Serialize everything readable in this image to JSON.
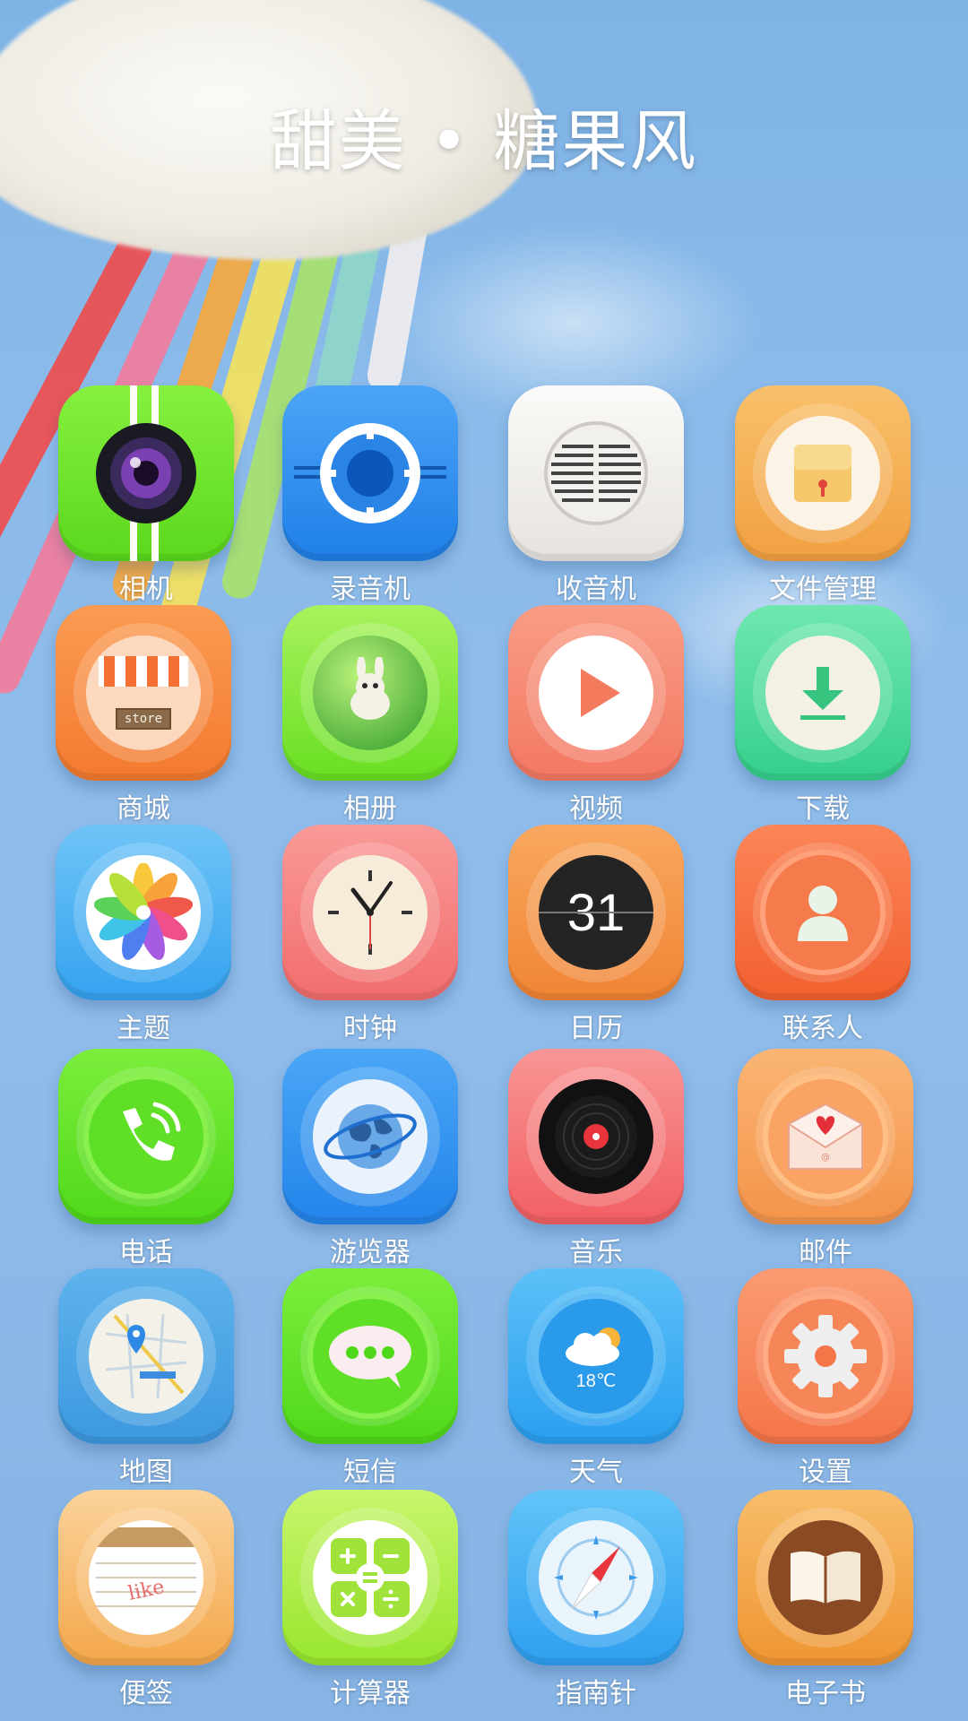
{
  "title": "甜美 • 糖果风",
  "apps": [
    {
      "label": "相机",
      "icon": "camera-icon",
      "color": "#6ee52c"
    },
    {
      "label": "录音机",
      "icon": "recorder-icon",
      "color": "#2f8ff0"
    },
    {
      "label": "收音机",
      "icon": "radio-icon",
      "color": "#efedea"
    },
    {
      "label": "文件管理",
      "icon": "folder-icon",
      "color": "#f6b05a"
    },
    {
      "label": "商城",
      "icon": "store-icon",
      "color": "#f98a43"
    },
    {
      "label": "相册",
      "icon": "album-icon",
      "color": "#86e93b"
    },
    {
      "label": "视频",
      "icon": "play-icon",
      "color": "#f7866f"
    },
    {
      "label": "下载",
      "icon": "download-icon",
      "color": "#49d99a"
    },
    {
      "label": "主题",
      "icon": "theme-flower-icon",
      "color": "#4fb4f4"
    },
    {
      "label": "时钟",
      "icon": "clock-icon",
      "color": "#f57f7f"
    },
    {
      "label": "日历",
      "icon": "calendar-icon",
      "color": "#f6954a"
    },
    {
      "label": "联系人",
      "icon": "contact-icon",
      "color": "#f86f43"
    },
    {
      "label": "电话",
      "icon": "phone-icon",
      "color": "#5fe32a"
    },
    {
      "label": "游览器",
      "icon": "browser-globe-icon",
      "color": "#3d98f2"
    },
    {
      "label": "音乐",
      "icon": "music-record-icon",
      "color": "#f5736f"
    },
    {
      "label": "邮件",
      "icon": "mail-icon",
      "color": "#f8a55d"
    },
    {
      "label": "地图",
      "icon": "map-icon",
      "color": "#4aa9e8"
    },
    {
      "label": "短信",
      "icon": "message-icon",
      "color": "#5fe32a"
    },
    {
      "label": "天气",
      "icon": "weather-icon",
      "color": "#3dacf3"
    },
    {
      "label": "设置",
      "icon": "gear-icon",
      "color": "#f8885d"
    },
    {
      "label": "便签",
      "icon": "notes-icon",
      "color": "#f7b763"
    },
    {
      "label": "计算器",
      "icon": "calculator-icon",
      "color": "#a6ec3c"
    },
    {
      "label": "指南针",
      "icon": "compass-icon",
      "color": "#3fb0f4"
    },
    {
      "label": "电子书",
      "icon": "ebook-icon",
      "color": "#f5a64a"
    }
  ],
  "icon_text": {
    "store_sign": "store",
    "calendar_day": "31",
    "weather_temp": "18℃",
    "notes_word": "like"
  }
}
